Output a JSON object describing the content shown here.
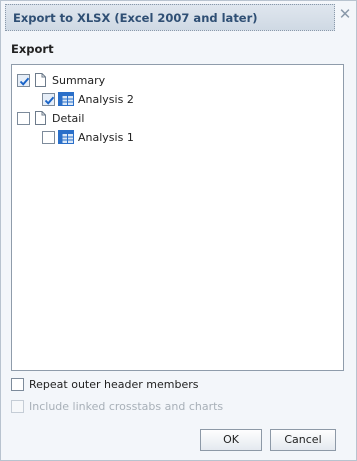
{
  "dialog": {
    "title": "Export to XLSX (Excel 2007 and later)",
    "close_glyph": "✕"
  },
  "section": {
    "label": "Export"
  },
  "tree": {
    "items": [
      {
        "label": "Summary",
        "checked": true,
        "icon": "document-icon",
        "level": 0
      },
      {
        "label": "Analysis 2",
        "checked": true,
        "icon": "crosstab-icon",
        "level": 1
      },
      {
        "label": "Detail",
        "checked": false,
        "icon": "document-icon",
        "level": 0
      },
      {
        "label": "Analysis 1",
        "checked": false,
        "icon": "crosstab-icon",
        "level": 1
      }
    ]
  },
  "options": {
    "repeat_outer_header": {
      "label": "Repeat outer header members",
      "checked": false,
      "enabled": true
    },
    "include_linked": {
      "label": "Include linked crosstabs and charts",
      "checked": false,
      "enabled": false
    }
  },
  "buttons": {
    "ok": "OK",
    "cancel": "Cancel"
  },
  "colors": {
    "accent": "#2f4f74",
    "check": "#1a64c8",
    "grid_blue": "#2a6fc9"
  }
}
